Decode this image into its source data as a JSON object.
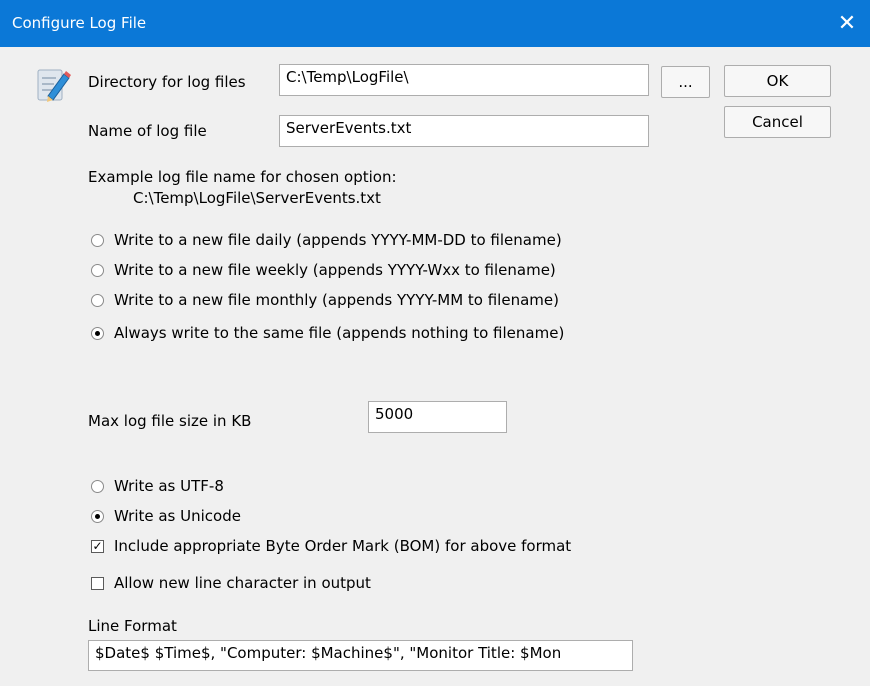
{
  "window": {
    "title": "Configure Log File",
    "close_glyph": "✕"
  },
  "form": {
    "directory_label": "Directory for log files",
    "directory_value": "C:\\Temp\\LogFile\\",
    "browse_label": "...",
    "name_label": "Name of log file",
    "name_value": "ServerEvents.txt",
    "example_label": "Example log file name for chosen option:",
    "example_value": "C:\\Temp\\LogFile\\ServerEvents.txt",
    "rotation_options": [
      "Write to a new file daily (appends YYYY-MM-DD to filename)",
      "Write to a new file weekly (appends YYYY-Wxx to filename)",
      "Write to a new file monthly (appends YYYY-MM to filename)",
      "Always write to the same file (appends nothing to filename)"
    ],
    "rotation_selected": 3,
    "max_size_label": "Max log file size in KB",
    "max_size_value": "5000",
    "encoding_options": [
      "Write as UTF-8",
      "Write as Unicode"
    ],
    "encoding_selected": 1,
    "bom_label": "Include appropriate Byte Order Mark (BOM) for above format",
    "bom_checked": true,
    "newline_label": "Allow new line character in output",
    "newline_checked": false,
    "line_format_label": "Line Format",
    "line_format_value": "$Date$ $Time$, \"Computer: $Machine$\", \"Monitor Title: $Mon"
  },
  "buttons": {
    "ok": "OK",
    "cancel": "Cancel"
  },
  "icons": {
    "dialog_icon": "edit-pencil-icon"
  }
}
